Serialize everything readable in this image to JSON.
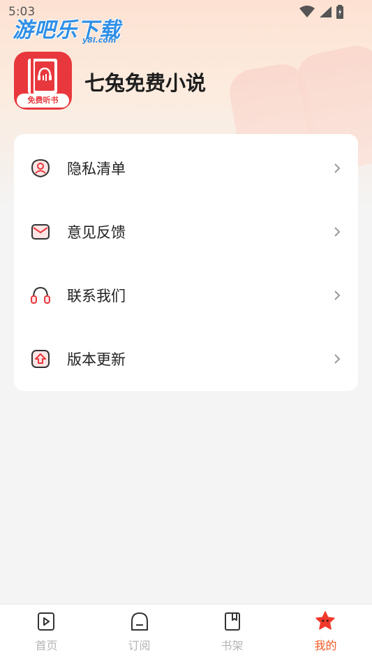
{
  "status_bar": {
    "time": "5:03"
  },
  "watermark": {
    "text": "游吧乐下载",
    "sub": "y8l.com"
  },
  "app": {
    "name": "七兔免费小说",
    "logo_badge": "免费听书",
    "logo_icon": "book-headphones-icon"
  },
  "menu": {
    "items": [
      {
        "label": "隐私清单",
        "icon": "privacy-user-icon"
      },
      {
        "label": "意见反馈",
        "icon": "mail-icon"
      },
      {
        "label": "联系我们",
        "icon": "headset-icon"
      },
      {
        "label": "版本更新",
        "icon": "update-arrow-icon"
      }
    ]
  },
  "tabs": [
    {
      "label": "首页",
      "icon": "play-book-icon",
      "active": false
    },
    {
      "label": "订阅",
      "icon": "subscribe-icon",
      "active": false
    },
    {
      "label": "书架",
      "icon": "bookshelf-icon",
      "active": false
    },
    {
      "label": "我的",
      "icon": "star-face-icon",
      "active": true
    }
  ],
  "colors": {
    "accent": "#f05a24",
    "brand_red": "#e8383d",
    "tab_inactive": "#b5b5b5"
  }
}
